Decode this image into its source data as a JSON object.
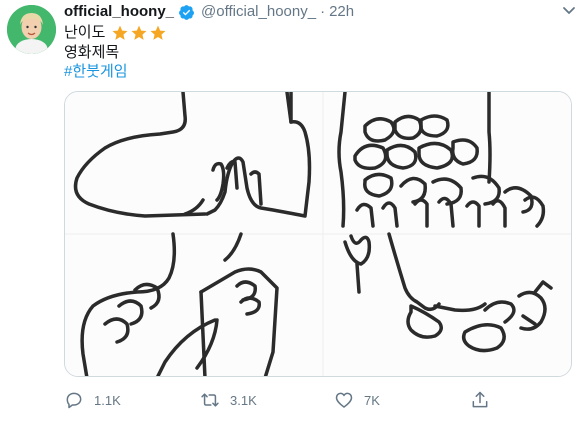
{
  "author": {
    "display_name": "official_hoony_",
    "handle": "@official_hoony_",
    "separator": "·",
    "time": "22h"
  },
  "tweet": {
    "line1": "난이도",
    "stars": 3,
    "line2": "영화제목",
    "hashtag": "#한붓게임"
  },
  "actions": {
    "replies": "1.1K",
    "retweets": "3.1K",
    "likes": "7K"
  },
  "colors": {
    "accent": "#1b95e0",
    "star": "#f5a623",
    "muted": "#657786"
  },
  "icons": [
    "verified-badge-icon",
    "star-icon",
    "reply-icon",
    "retweet-icon",
    "like-icon",
    "share-icon",
    "chevron-down-icon"
  ]
}
